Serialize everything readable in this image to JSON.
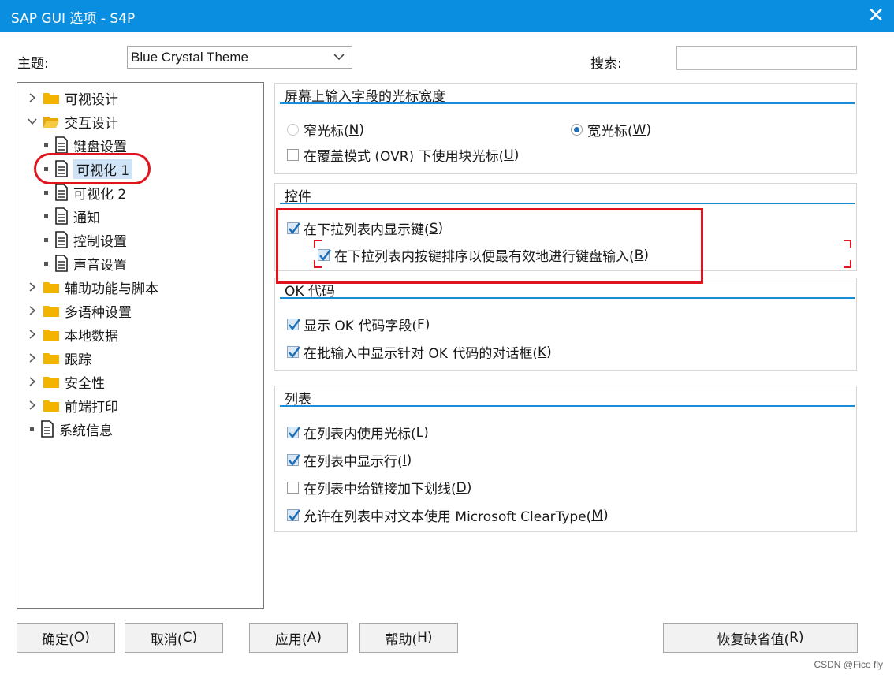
{
  "window": {
    "title": "SAP GUI 选项 - S4P",
    "close_glyph": "✕"
  },
  "header": {
    "theme_label": "主题:",
    "theme_value": "Blue Crystal Theme",
    "search_label": "搜索:",
    "search_value": ""
  },
  "tree": [
    {
      "label": "可视设计",
      "level": 0,
      "kind": "folder",
      "expanded": false
    },
    {
      "label": "交互设计",
      "level": 0,
      "kind": "folder",
      "expanded": true
    },
    {
      "label": "键盘设置",
      "level": 1,
      "kind": "page"
    },
    {
      "label": "可视化 1",
      "level": 1,
      "kind": "page",
      "selected": true
    },
    {
      "label": "可视化 2",
      "level": 1,
      "kind": "page"
    },
    {
      "label": "通知",
      "level": 1,
      "kind": "page"
    },
    {
      "label": "控制设置",
      "level": 1,
      "kind": "page"
    },
    {
      "label": "声音设置",
      "level": 1,
      "kind": "page"
    },
    {
      "label": "辅助功能与脚本",
      "level": 0,
      "kind": "folder",
      "expanded": false
    },
    {
      "label": "多语种设置",
      "level": 0,
      "kind": "folder",
      "expanded": false
    },
    {
      "label": "本地数据",
      "level": 0,
      "kind": "folder",
      "expanded": false
    },
    {
      "label": "跟踪",
      "level": 0,
      "kind": "folder",
      "expanded": false
    },
    {
      "label": "安全性",
      "level": 0,
      "kind": "folder",
      "expanded": false
    },
    {
      "label": "前端打印",
      "level": 0,
      "kind": "folder",
      "expanded": false
    },
    {
      "label": "系统信息",
      "level": 0,
      "kind": "page"
    }
  ],
  "groups": {
    "cursor": {
      "title": "屏幕上输入字段的光标宽度",
      "narrow": {
        "text": "窄光标(",
        "key": "N",
        "end": ")",
        "checked": false
      },
      "wide": {
        "text": "宽光标(",
        "key": "W",
        "end": ")",
        "checked": true
      },
      "block": {
        "text": "在覆盖模式 (OVR) 下使用块光标(",
        "key": "U",
        "end": ")",
        "checked": false
      }
    },
    "controls": {
      "title": "控件",
      "show_keys": {
        "text": "在下拉列表内显示键(",
        "key": "S",
        "end": ")",
        "checked": true
      },
      "sort_keys": {
        "text": "在下拉列表内按键排序以便最有效地进行键盘输入(",
        "key": "B",
        "end": ")",
        "checked": true
      }
    },
    "okcode": {
      "title": "OK 代码",
      "show_field": {
        "text": "显示 OK 代码字段(",
        "key": "F",
        "end": ")",
        "checked": true
      },
      "batch_dialog": {
        "text": "在批输入中显示针对 OK 代码的对话框(",
        "key": "K",
        "end": ")",
        "checked": true
      }
    },
    "lists": {
      "title": "列表",
      "cursor": {
        "text": "在列表内使用光标(",
        "key": "L",
        "end": ")",
        "checked": true
      },
      "rows": {
        "text": "在列表中显示行(",
        "key": "I",
        "end": ")",
        "checked": true
      },
      "underline": {
        "text": "在列表中给链接加下划线(",
        "key": "D",
        "end": ")",
        "checked": false
      },
      "cleartype": {
        "text": "允许在列表中对文本使用 Microsoft ClearType(",
        "key": "M",
        "end": ")",
        "checked": true
      }
    }
  },
  "buttons": {
    "ok": {
      "text": "确定(",
      "key": "O",
      "end": ")"
    },
    "cancel": {
      "text": "取消(",
      "key": "C",
      "end": ")"
    },
    "apply": {
      "text": "应用(",
      "key": "A",
      "end": ")"
    },
    "help": {
      "text": "帮助(",
      "key": "H",
      "end": ")"
    },
    "restore": {
      "text": "恢复缺省值(",
      "key": "R",
      "end": ")"
    }
  },
  "watermark": "CSDN @Fico fly",
  "colors": {
    "titlebar": "#0a8ee0",
    "accent_line": "#1a8cd8",
    "annotation_red": "#e0141e",
    "folder": "#f3b400"
  }
}
